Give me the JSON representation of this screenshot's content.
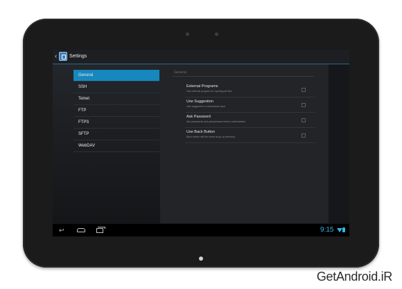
{
  "actionbar": {
    "title": "Settings"
  },
  "nav": {
    "items": [
      {
        "label": "General",
        "active": true
      },
      {
        "label": "SSH"
      },
      {
        "label": "Telnet"
      },
      {
        "label": "FTP"
      },
      {
        "label": "FTPS"
      },
      {
        "label": "SFTP"
      },
      {
        "label": "WebDAV"
      }
    ]
  },
  "general": {
    "header": "General",
    "prefs": [
      {
        "title": "External Programs",
        "summary": "Use external program for opening all files",
        "checked": false
      },
      {
        "title": "Use Suggestion",
        "summary": "Use suggestion in commands input",
        "checked": false
      },
      {
        "title": "Ask Password",
        "summary": "Ask passwords and passphrases before authorization",
        "checked": false
      },
      {
        "title": "Use Back Button",
        "summary": "Back button will the same as go up directory",
        "checked": false
      }
    ]
  },
  "statusbar": {
    "time": "9:15"
  },
  "icons": {
    "back": "back-icon",
    "home": "home-icon",
    "recents": "recent-apps-icon",
    "wifi": "wifi-icon",
    "battery": "battery-icon",
    "app": "app-logo-icon"
  },
  "colors": {
    "accent": "#1787bf",
    "holo_blue": "#33b5e5"
  },
  "watermark": "GetAndroid.iR"
}
